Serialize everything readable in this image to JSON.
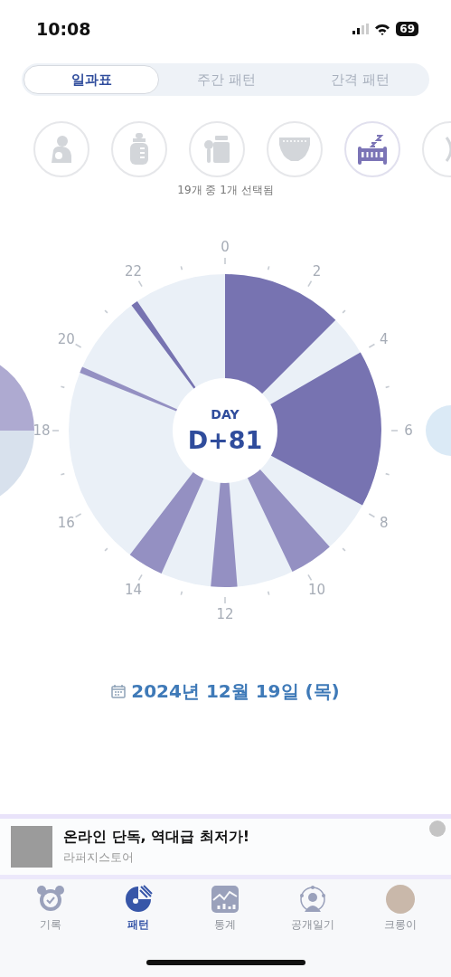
{
  "status_bar": {
    "time": "10:08",
    "battery": "69"
  },
  "tabs": [
    {
      "label": "일과표",
      "selected": true
    },
    {
      "label": "주간 패턴",
      "selected": false
    },
    {
      "label": "간격 패턴",
      "selected": false
    }
  ],
  "categories": [
    {
      "kind": "breastfeeding",
      "selected": false
    },
    {
      "kind": "bottle",
      "selected": false
    },
    {
      "kind": "babyfood",
      "selected": false
    },
    {
      "kind": "diaper",
      "selected": false
    },
    {
      "kind": "sleep",
      "selected": true
    },
    {
      "kind": "partial",
      "selected": false
    }
  ],
  "selection_count": "19개 중 1개 선택됨",
  "clock": {
    "hour_labels": [
      "0",
      "2",
      "4",
      "6",
      "8",
      "10",
      "12",
      "14",
      "16",
      "18",
      "20",
      "22"
    ],
    "center_caption": "DAY",
    "center_value": "D+81"
  },
  "date": "2024년 12월 19일 (목)",
  "ad": {
    "title": "온라인 단독, 역대급 최저가!",
    "advertiser": "라퍼지스토어"
  },
  "nav": [
    {
      "kind": "alarm",
      "label": "기록",
      "selected": false
    },
    {
      "kind": "pattern",
      "label": "패턴",
      "selected": true
    },
    {
      "kind": "stats",
      "label": "통계",
      "selected": false
    },
    {
      "kind": "public",
      "label": "공개일기",
      "selected": false
    },
    {
      "kind": "avatar",
      "label": "크롱이",
      "selected": false
    }
  ]
}
